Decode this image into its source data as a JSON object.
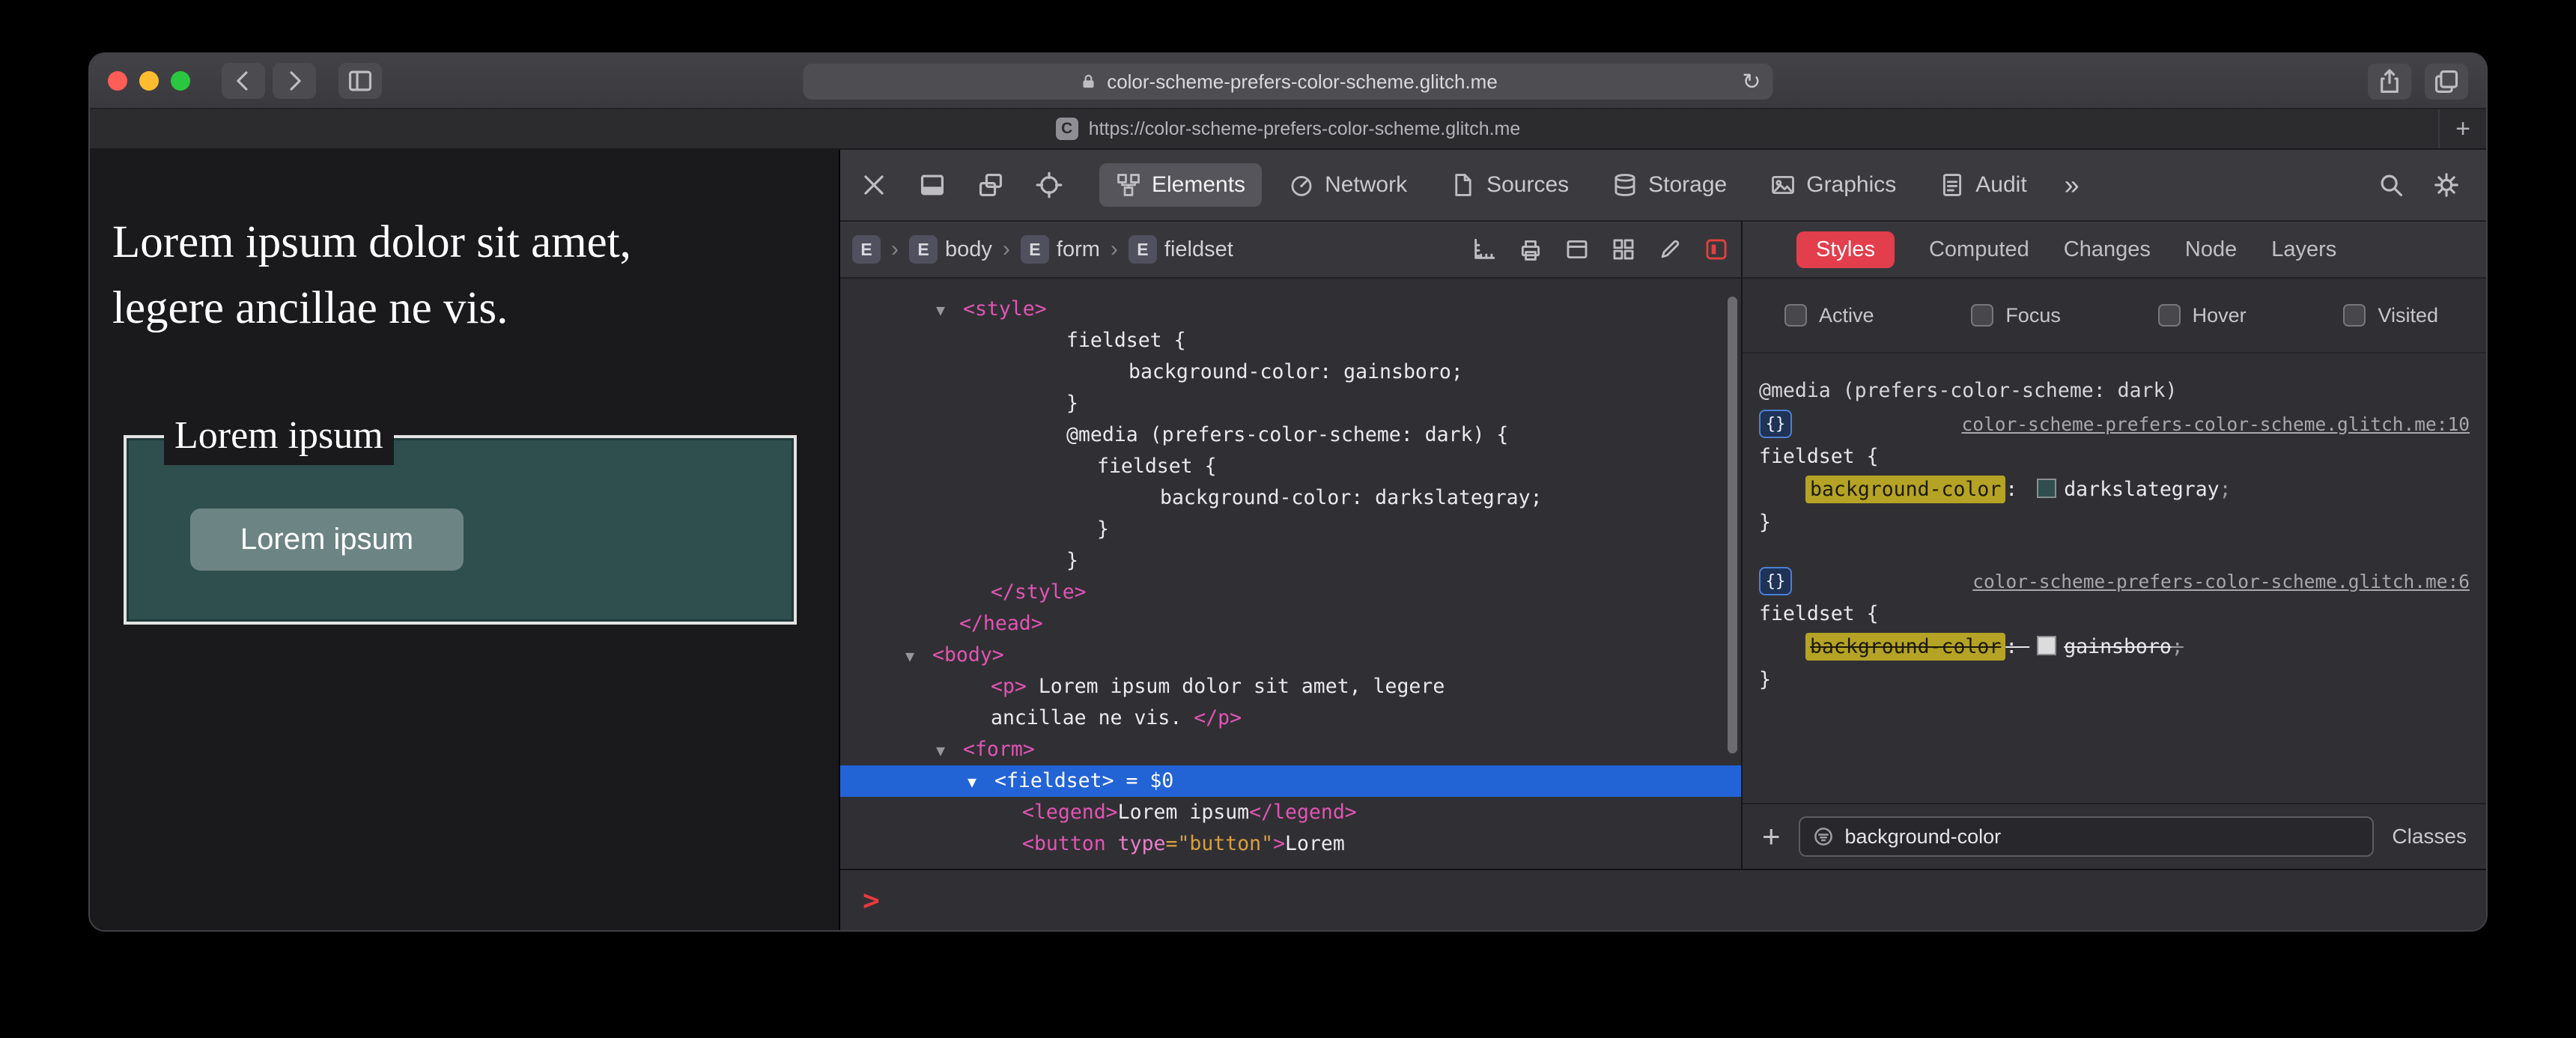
{
  "colors": {
    "selection_blue": "#2263d6",
    "highlight_yellow": "#b5a325",
    "accent_red": "#e23e4c",
    "darkslategray": "#2f4f4f",
    "gainsboro": "#dcdcdc"
  },
  "icons": {
    "reload": "↻",
    "more_tabs": "»",
    "new_tab": "+",
    "favicon": "C",
    "crumb_separator": "›",
    "rule_badge": "{}",
    "add_rule": "+",
    "console_prompt": ">"
  },
  "window": {
    "url_bar": {
      "url": "color-scheme-prefers-color-scheme.glitch.me"
    },
    "tab_bar": {
      "tab_title": "https://color-scheme-prefers-color-scheme.glitch.me"
    }
  },
  "page": {
    "paragraph_lines": [
      "Lorem ipsum dolor sit amet,",
      "legere ancillae ne vis."
    ],
    "fieldset": {
      "legend": "Lorem ipsum",
      "button": "Lorem ipsum",
      "background": "#2f4f4f"
    }
  },
  "devtools": {
    "toolbar": {
      "window_icons": [
        "close-devtools-icon",
        "dock-bottom-icon",
        "detach-icon",
        "inspect-target-icon"
      ],
      "tabs": [
        {
          "label": "Elements",
          "icon": "elements-icon",
          "selected": true
        },
        {
          "label": "Network",
          "icon": "network-icon",
          "selected": false
        },
        {
          "label": "Sources",
          "icon": "sources-icon",
          "selected": false
        },
        {
          "label": "Storage",
          "icon": "storage-icon",
          "selected": false
        },
        {
          "label": "Graphics",
          "icon": "graphics-icon",
          "selected": false
        },
        {
          "label": "Audit",
          "icon": "audit-icon",
          "selected": false
        }
      ]
    },
    "breadcrumbs": [
      {
        "badge": "E",
        "label": ""
      },
      {
        "badge": "E",
        "label": "body"
      },
      {
        "badge": "E",
        "label": "form"
      },
      {
        "badge": "E",
        "label": "fieldset"
      }
    ],
    "panel_icons": [
      {
        "name": "rulers-icon",
        "active": false
      },
      {
        "name": "print-icon",
        "active": false
      },
      {
        "name": "layout-icon",
        "active": false
      },
      {
        "name": "grid-icon",
        "active": false
      },
      {
        "name": "edit-icon",
        "active": false
      },
      {
        "name": "element-picker-icon",
        "active": true
      }
    ],
    "dom_lines": [
      {
        "indent": 128,
        "selected": false,
        "segs": [
          {
            "t": "▼",
            "c": "tri"
          },
          {
            "t": "<style>",
            "c": "tag"
          }
        ]
      },
      {
        "indent": 302,
        "selected": false,
        "segs": [
          {
            "t": "fieldset {",
            "c": "plain"
          }
        ]
      },
      {
        "indent": 385,
        "selected": false,
        "segs": [
          {
            "t": "background-color: gainsboro;",
            "c": "plain"
          }
        ]
      },
      {
        "indent": 302,
        "selected": false,
        "segs": [
          {
            "t": "}",
            "c": "plain"
          }
        ]
      },
      {
        "indent": 302,
        "selected": false,
        "segs": [
          {
            "t": "@media (prefers-color-scheme: dark) {",
            "c": "plain"
          }
        ]
      },
      {
        "indent": 343,
        "selected": false,
        "segs": [
          {
            "t": "fieldset {",
            "c": "plain"
          }
        ]
      },
      {
        "indent": 427,
        "selected": false,
        "segs": [
          {
            "t": "background-color: darkslategray;",
            "c": "plain"
          }
        ]
      },
      {
        "indent": 343,
        "selected": false,
        "segs": [
          {
            "t": "}",
            "c": "plain"
          }
        ]
      },
      {
        "indent": 302,
        "selected": false,
        "segs": [
          {
            "t": "}",
            "c": "plain"
          }
        ]
      },
      {
        "indent": 201,
        "selected": false,
        "segs": [
          {
            "t": "</style>",
            "c": "tag"
          }
        ]
      },
      {
        "indent": 159,
        "selected": false,
        "segs": [
          {
            "t": "</head>",
            "c": "tag"
          }
        ]
      },
      {
        "indent": 87,
        "selected": false,
        "segs": [
          {
            "t": "▼",
            "c": "tri"
          },
          {
            "t": "<body>",
            "c": "tag"
          }
        ]
      },
      {
        "indent": 201,
        "selected": false,
        "segs": [
          {
            "t": "<p>",
            "c": "tag"
          },
          {
            "t": " Lorem ipsum dolor sit amet, legere",
            "c": "plain"
          }
        ]
      },
      {
        "indent": 201,
        "selected": false,
        "segs": [
          {
            "t": "ancillae ne vis. ",
            "c": "plain"
          },
          {
            "t": "</p>",
            "c": "tag"
          }
        ]
      },
      {
        "indent": 128,
        "selected": false,
        "segs": [
          {
            "t": "▼",
            "c": "tri"
          },
          {
            "t": "<form>",
            "c": "tag"
          }
        ]
      },
      {
        "indent": 170,
        "selected": true,
        "segs": [
          {
            "t": "▼",
            "c": "tri"
          },
          {
            "t": "<fieldset>",
            "c": "tag"
          },
          {
            "t": " = $0",
            "c": "plain"
          }
        ]
      },
      {
        "indent": 243,
        "selected": false,
        "segs": [
          {
            "t": "<legend>",
            "c": "tag"
          },
          {
            "t": "Lorem ipsum",
            "c": "plain"
          },
          {
            "t": "</legend>",
            "c": "tag"
          }
        ]
      },
      {
        "indent": 243,
        "selected": false,
        "segs": [
          {
            "t": "<button",
            "c": "tag"
          },
          {
            "t": " ",
            "c": "plain"
          },
          {
            "t": "type",
            "c": "attr"
          },
          {
            "t": "=\"button\"",
            "c": "val"
          },
          {
            "t": ">",
            "c": "tag"
          },
          {
            "t": "Lorem",
            "c": "plain"
          }
        ]
      }
    ],
    "sidebar": {
      "tabs": [
        {
          "label": "Styles",
          "selected": true
        },
        {
          "label": "Computed",
          "selected": false
        },
        {
          "label": "Changes",
          "selected": false
        },
        {
          "label": "Node",
          "selected": false
        },
        {
          "label": "Layers",
          "selected": false
        }
      ],
      "pseudo": [
        "Active",
        "Focus",
        "Hover",
        "Visited"
      ],
      "rules": [
        {
          "media": "@media (prefers-color-scheme: dark)",
          "link": "color-scheme-prefers-color-scheme.glitch.me:10",
          "selector": "fieldset {",
          "property": "background-color",
          "value": "darkslategray",
          "swatch": "#2f4f4f",
          "overridden": false,
          "close": "}"
        },
        {
          "media": "",
          "link": "color-scheme-prefers-color-scheme.glitch.me:6",
          "selector": "fieldset {",
          "property": "background-color",
          "value": "gainsboro",
          "swatch": "#dcdcdc",
          "overridden": true,
          "close": "}"
        }
      ],
      "filter": {
        "value": "background-color",
        "classes_label": "Classes"
      }
    }
  }
}
